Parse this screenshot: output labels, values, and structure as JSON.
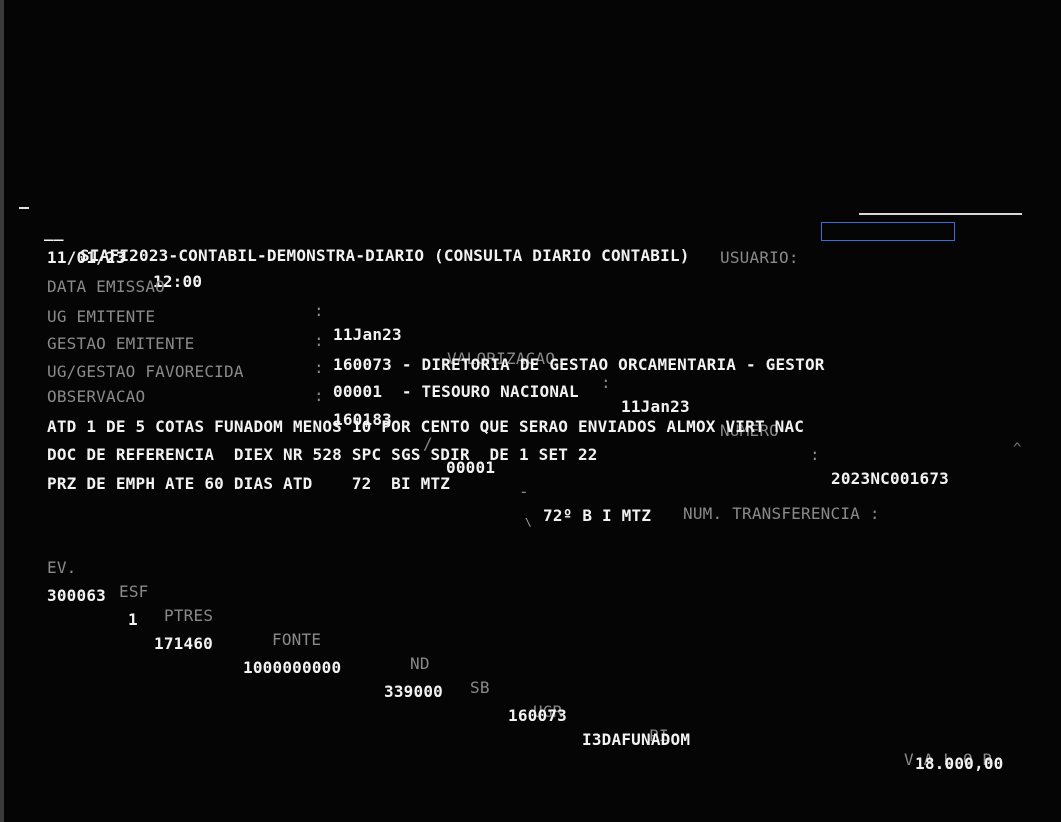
{
  "header": {
    "title": "SIAFI2023-CONTABIL-DEMONSTRA-DIARIO (CONSULTA DIARIO CONTABIL)",
    "prefix": "__",
    "date": "11/01/23",
    "time": "12:00",
    "user_label": "USUARIO:"
  },
  "fields": {
    "data_emissao_label": "DATA EMISSAO",
    "data_emissao_value": "11Jan23",
    "valorizacao_label": "VALORIZACAO",
    "valorizacao_value": "11Jan23",
    "numero_label": "NUMERO",
    "numero_value": "2023NC001673",
    "ug_emitente_label": "UG EMITENTE",
    "ug_emitente_value": "160073 - DIRETORIA DE GESTAO ORCAMENTARIA - GESTOR",
    "gestao_emitente_label": "GESTAO EMITENTE",
    "gestao_emitente_value": "00001  - TESOURO NACIONAL",
    "ug_gestao_favorecida_label": "UG/GESTAO FAVORECIDA",
    "ug_favorecida_value": "160183",
    "gestao_favorecida_value": "00001",
    "favorecida_name": "72º B I MTZ",
    "separator_colon": ":",
    "separator_slash": "/",
    "separator_dash": "-"
  },
  "observacao": {
    "label": "OBSERVACAO",
    "lines": [
      "ATD 1 DE 5 COTAS FUNADOM MENOS 10 POR CENTO QUE SERAO ENVIADOS ALMOX VIRT NAC",
      "DOC DE REFERENCIA  DIEX NR 528 SPC SGS SDIR  DE 1 SET 22",
      "PRZ DE EMPH ATE 60 DIAS ATD    72  BI MTZ"
    ]
  },
  "transferencia": {
    "label": "NUM. TRANSFERENCIA :"
  },
  "table": {
    "headers": {
      "ev": "EV.",
      "esf": "ESF",
      "ptres": "PTRES",
      "fonte": "FONTE",
      "nd": "ND",
      "sb": "SB",
      "ugr": "UGR",
      "pi": "PI",
      "valor": "V A L O R"
    },
    "rows": [
      {
        "ev": "300063",
        "esf": "1",
        "ptres": "171460",
        "fonte": "1000000000",
        "nd": "339000",
        "ugr": "160073",
        "pi": "I3DAFUNADOM",
        "valor": "18.000,00"
      }
    ]
  },
  "colors": {
    "background": "#050505",
    "text_bright": "#f2f2f2",
    "text_dim": "#8a8a8a",
    "user_box_border": "#3b6cd8"
  }
}
